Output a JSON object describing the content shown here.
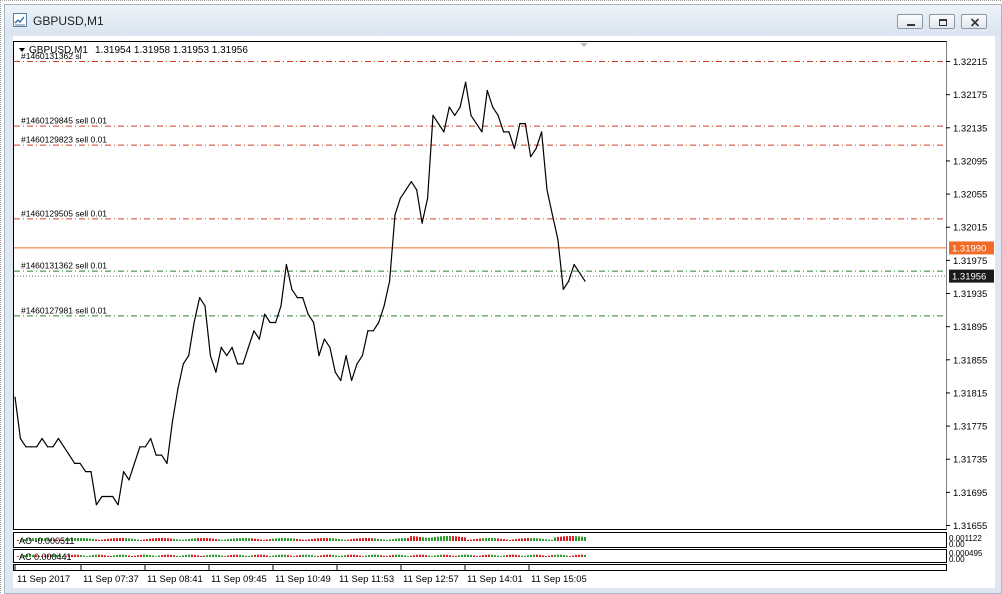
{
  "window": {
    "title": "GBPUSD,M1"
  },
  "chart_header": {
    "symbol": "GBPUSD,M1",
    "ohlc": "1.31954 1.31958 1.31953 1.31956"
  },
  "colors": {
    "sell_level": "#d1402a",
    "sl_level": "#2f7d32",
    "current_price_line": "#f06a28",
    "bid_line": "#1a1a1a",
    "ao_up": "#2c9c2c",
    "ao_down": "#d62020"
  },
  "orders": [
    {
      "label": "#1460131362 sl",
      "price": 1.32215,
      "kind": "sl-upper"
    },
    {
      "label": "#1460129845 sell 0.01",
      "price": 1.32137,
      "kind": "sell"
    },
    {
      "label": "#1460129823 sell 0.01",
      "price": 1.32114,
      "kind": "sell"
    },
    {
      "label": "#1460129505 sell 0.01",
      "price": 1.32025,
      "kind": "sell"
    },
    {
      "label": "#1460131362 sell 0.01",
      "price": 1.31962,
      "kind": "sell-green"
    },
    {
      "label": "#1460127981 sell 0.01",
      "price": 1.31908,
      "kind": "sell-green"
    }
  ],
  "price_labels": {
    "ask": "1.31990",
    "bid": "1.31956"
  },
  "indicators": {
    "ao": {
      "label": "AO -0.000511",
      "scale_top": "0.001122",
      "scale_bottom": "0.00"
    },
    "ac": {
      "label": "AC 0.000441",
      "scale_top": "0.000495",
      "scale_bottom": "0.00"
    }
  },
  "time_axis": [
    "11 Sep 2017",
    "11 Sep 07:37",
    "11 Sep 08:41",
    "11 Sep 09:45",
    "11 Sep 10:49",
    "11 Sep 11:53",
    "11 Sep 12:57",
    "11 Sep 14:01",
    "11 Sep 15:05"
  ],
  "chart_data": {
    "type": "line",
    "title": "GBPUSD,M1",
    "ylim": [
      1.3165,
      1.3222
    ],
    "y_ticks": [
      "1.32215",
      "1.32175",
      "1.32135",
      "1.32095",
      "1.32055",
      "1.32015",
      "1.31975",
      "1.31935",
      "1.31895",
      "1.31855",
      "1.31815",
      "1.31775",
      "1.31735",
      "1.31695",
      "1.31655"
    ],
    "x_ticks": [
      "11 Sep 2017",
      "11 Sep 07:37",
      "11 Sep 08:41",
      "11 Sep 09:45",
      "11 Sep 10:49",
      "11 Sep 11:53",
      "11 Sep 12:57",
      "11 Sep 14:01",
      "11 Sep 15:05"
    ],
    "series": [
      {
        "values": [
          1.3181,
          1.3176,
          1.3175,
          1.3175,
          1.3175,
          1.3176,
          1.3175,
          1.3175,
          1.3176,
          1.3175,
          1.3174,
          1.3173,
          1.3173,
          1.3172,
          1.3172,
          1.3168,
          1.3169,
          1.3169,
          1.3169,
          1.3168,
          1.3172,
          1.3171,
          1.3173,
          1.3175,
          1.3175,
          1.3176,
          1.3174,
          1.3174,
          1.3173,
          1.3178,
          1.3182,
          1.3185,
          1.3186,
          1.319,
          1.3193,
          1.3192,
          1.3186,
          1.3184,
          1.3187,
          1.3186,
          1.3187,
          1.3185,
          1.3185,
          1.3187,
          1.3189,
          1.3188,
          1.3191,
          1.319,
          1.319,
          1.3192,
          1.3197,
          1.3194,
          1.3193,
          1.3193,
          1.3191,
          1.319,
          1.3186,
          1.3188,
          1.3187,
          1.3184,
          1.3183,
          1.3186,
          1.3183,
          1.3185,
          1.3186,
          1.3189,
          1.3189,
          1.319,
          1.3192,
          1.3195,
          1.3203,
          1.3205,
          1.3206,
          1.3207,
          1.3206,
          1.3202,
          1.3205,
          1.3215,
          1.3214,
          1.3213,
          1.3216,
          1.3215,
          1.3216,
          1.3219,
          1.3215,
          1.3214,
          1.3213,
          1.3218,
          1.3216,
          1.3215,
          1.3213,
          1.3213,
          1.3211,
          1.3214,
          1.3214,
          1.321,
          1.3211,
          1.3213,
          1.3206,
          1.3203,
          1.32,
          1.3194,
          1.3195,
          1.3197,
          1.3196,
          1.3195
        ]
      }
    ]
  }
}
